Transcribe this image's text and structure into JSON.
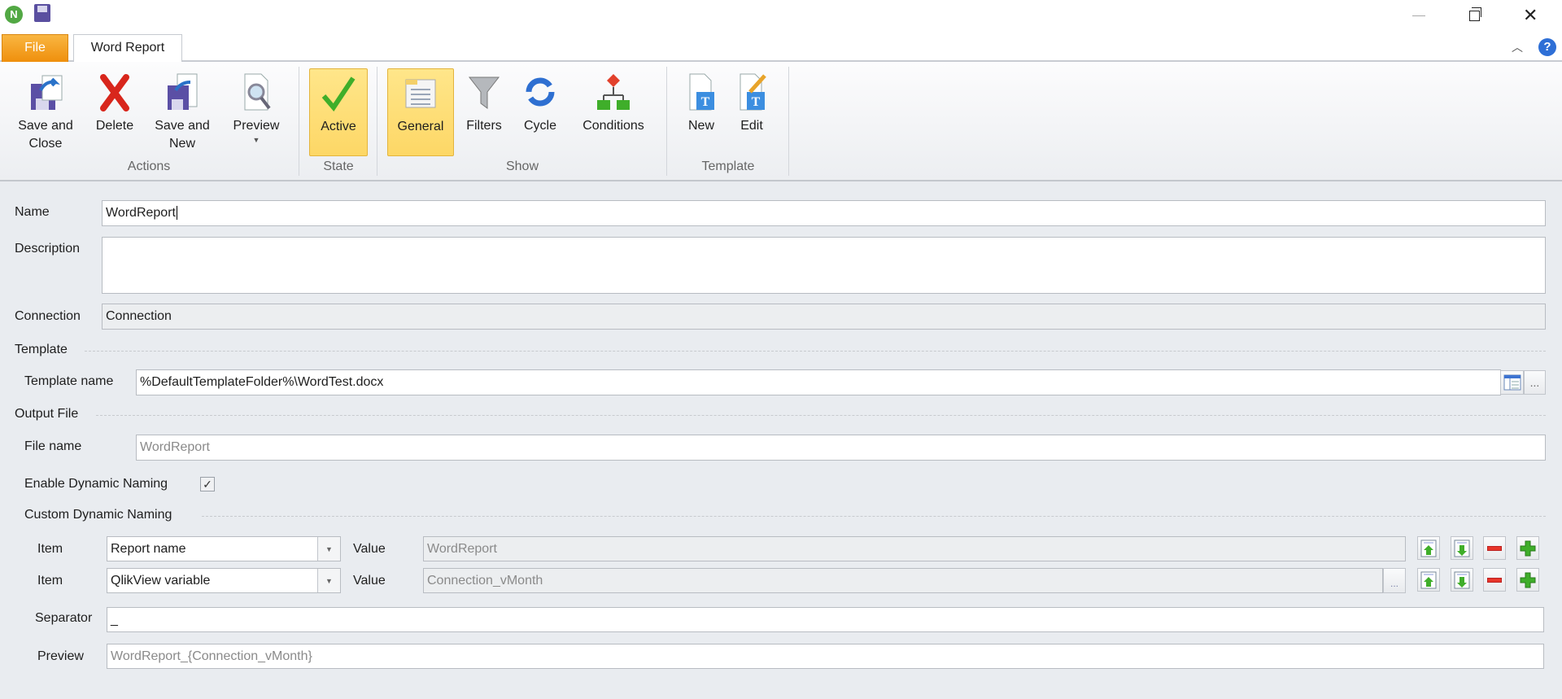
{
  "window": {
    "title_icons": [
      "qlik-logo-icon",
      "save-icon"
    ]
  },
  "tabs": {
    "file": "File",
    "word_report": "Word Report"
  },
  "ribbon": {
    "groups": {
      "actions": "Actions",
      "state": "State",
      "show": "Show",
      "template": "Template"
    },
    "save_close": [
      "Save and",
      "Close"
    ],
    "delete": "Delete",
    "save_new": [
      "Save and",
      "New"
    ],
    "preview": "Preview",
    "active": "Active",
    "general": "General",
    "filters": "Filters",
    "cycle": "Cycle",
    "conditions": "Conditions",
    "new": "New",
    "edit": "Edit"
  },
  "form": {
    "name_label": "Name",
    "name_value": "WordReport",
    "description_label": "Description",
    "description_value": "",
    "connection_label": "Connection",
    "connection_value": "Connection",
    "template_section": "Template",
    "template_name_label": "Template name",
    "template_name_value": "%DefaultTemplateFolder%\\WordTest.docx",
    "output_section": "Output File",
    "file_name_label": "File name",
    "file_name_value": "WordReport",
    "enable_dynamic_label": "Enable Dynamic Naming",
    "enable_dynamic_checked": true,
    "custom_section": "Custom Dynamic Naming",
    "items": [
      {
        "item_label": "Item",
        "item_value": "Report name",
        "value_label": "Value",
        "value": "WordReport"
      },
      {
        "item_label": "Item",
        "item_value": "QlikView variable",
        "value_label": "Value",
        "value": "Connection_vMonth"
      }
    ],
    "separator_label": "Separator",
    "separator_value": "_",
    "preview_label": "Preview",
    "preview_value": "WordReport_{Connection_vMonth}",
    "ellipsis": "..."
  }
}
